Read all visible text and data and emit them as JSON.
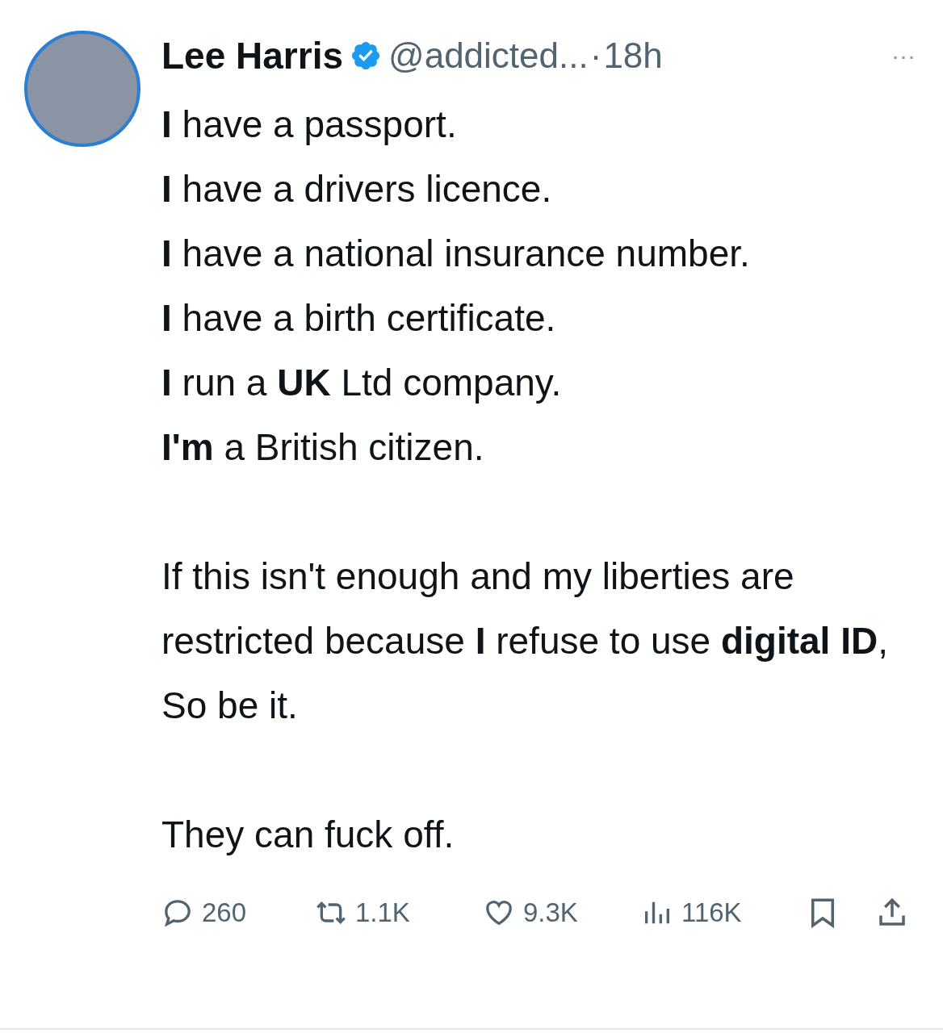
{
  "author": {
    "name": "Lee Harris",
    "verified": true,
    "handle": "@addicted...",
    "separator": "·",
    "time": "18h"
  },
  "more": "···",
  "paragraphs": [
    {
      "lines": [
        "**I** have a passport.",
        "**I** have a drivers licence.",
        "**I** have a national insurance number.",
        "**I** have a birth certificate.",
        "**I** run a **UK** Ltd company.",
        "**I'm** a British citizen."
      ]
    },
    {
      "lines": [
        "If this isn't enough and my liberties are restricted because **I** refuse to use **digital ID**, So be it."
      ]
    },
    {
      "lines": [
        "They can fuck off."
      ]
    }
  ],
  "actions": [
    {
      "kind": "reply",
      "count": "260"
    },
    {
      "kind": "repost",
      "count": "1.1K"
    },
    {
      "kind": "like",
      "count": "9.3K"
    },
    {
      "kind": "views",
      "count": "116K"
    },
    {
      "kind": "bookmark"
    },
    {
      "kind": "share"
    }
  ]
}
